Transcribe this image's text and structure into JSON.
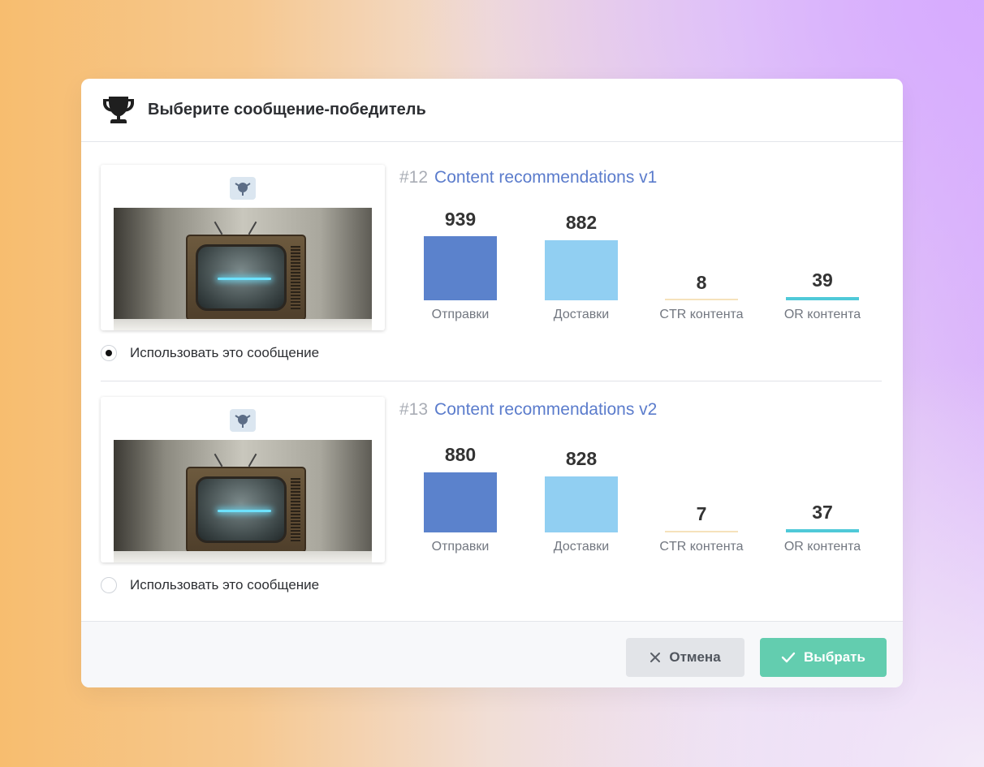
{
  "modal": {
    "title": "Выберите сообщение-победитель",
    "icon": "trophy-icon"
  },
  "messages": [
    {
      "id": "#12",
      "name": "Content recommendations v1",
      "selected": true,
      "radio_label": "Использовать это сообщение",
      "metrics": [
        {
          "label": "Отправки",
          "value": "939",
          "color": "#5b82cc"
        },
        {
          "label": "Доставки",
          "value": "882",
          "color": "#91cff2"
        },
        {
          "label": "CTR контента",
          "value": "8",
          "color": "#f6e2bb"
        },
        {
          "label": "OR контента",
          "value": "39",
          "color": "#4fc9d8"
        }
      ]
    },
    {
      "id": "#13",
      "name": "Content recommendations v2",
      "selected": false,
      "radio_label": "Использовать это сообщение",
      "metrics": [
        {
          "label": "Отправки",
          "value": "880",
          "color": "#5b82cc"
        },
        {
          "label": "Доставки",
          "value": "828",
          "color": "#91cff2"
        },
        {
          "label": "CTR контента",
          "value": "7",
          "color": "#f6e2bb"
        },
        {
          "label": "OR контента",
          "value": "37",
          "color": "#4fc9d8"
        }
      ]
    }
  ],
  "footer": {
    "cancel_label": "Отмена",
    "cancel_icon": "close-icon",
    "ok_label": "Выбрать",
    "ok_icon": "check-icon"
  }
}
